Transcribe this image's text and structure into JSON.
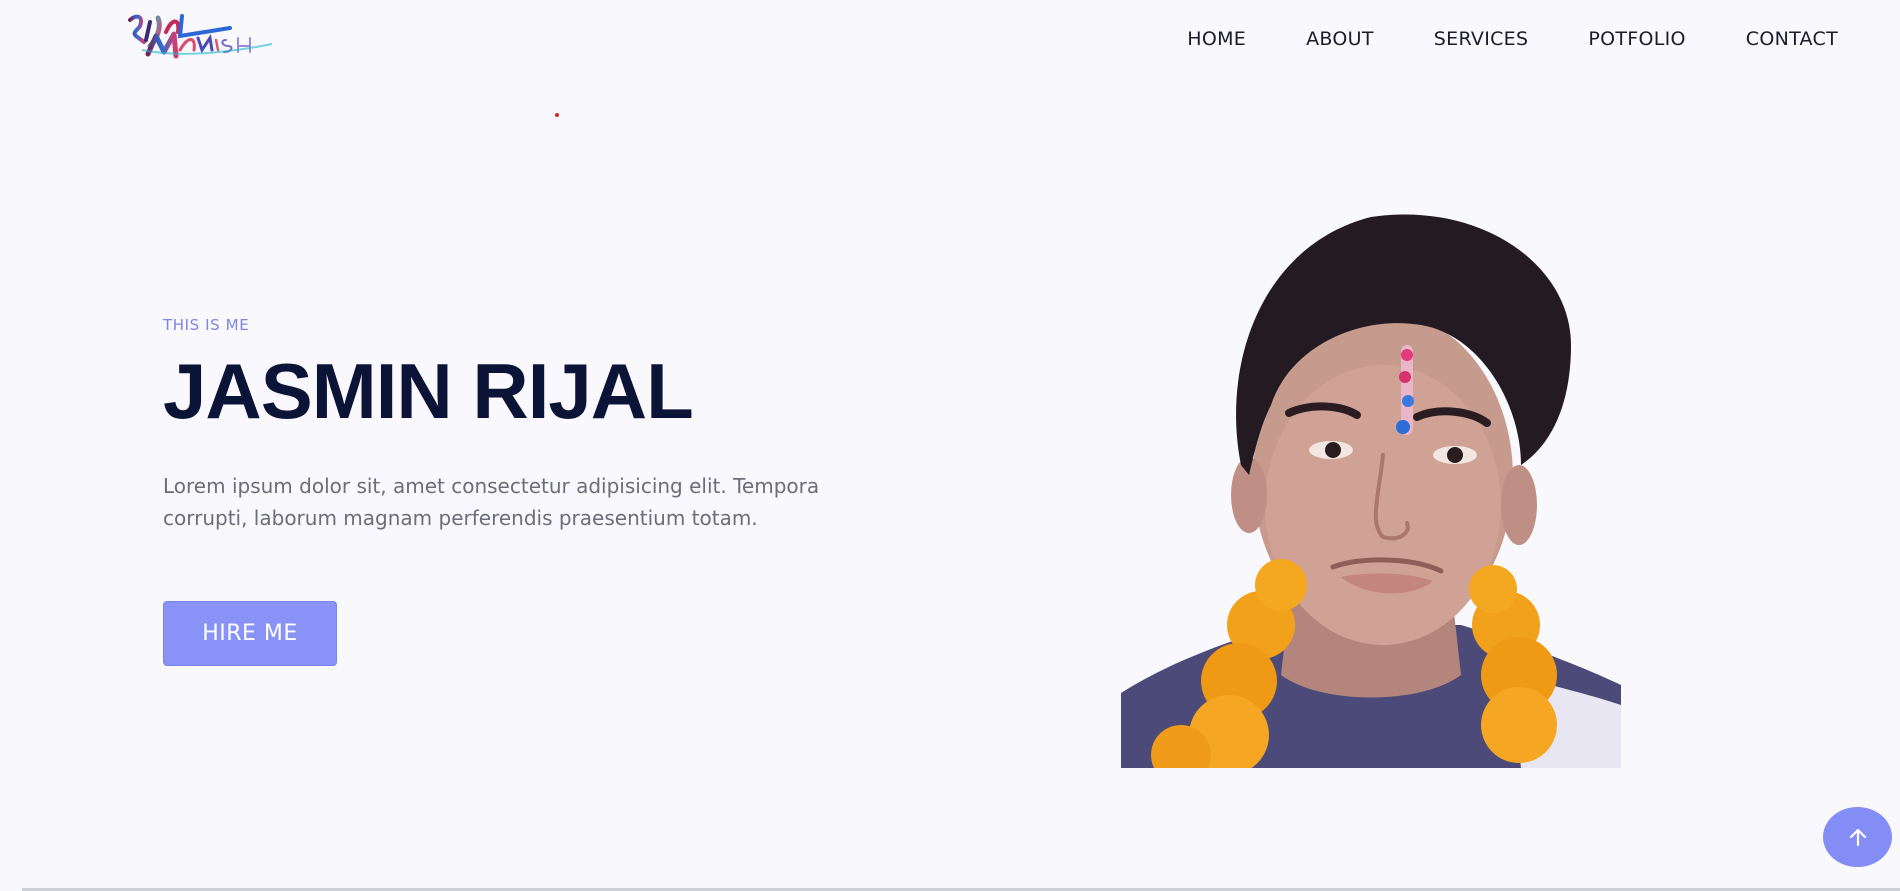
{
  "logo": {
    "alt_text": "RIJAL MANISH",
    "icon": "brand-logo"
  },
  "nav": {
    "items": [
      "HOME",
      "ABOUT",
      "SERVICES",
      "POTFOLIO",
      "CONTACT"
    ]
  },
  "hero": {
    "eyebrow": "THIS IS ME",
    "name": "JASMIN RIJAL",
    "description": "Lorem ipsum dolor sit, amet consectetur adipisicing elit. Tempora corrupti, laborum magnam perferendis praesentium totam.",
    "cta_label": "HIRE ME"
  },
  "portrait": {
    "icon": "profile-photo"
  },
  "scroll_top": {
    "icon": "arrow-up-icon"
  },
  "colors": {
    "background": "#f8f8fd",
    "accent": "#8992f6",
    "heading": "#0b1437",
    "eyebrow": "#7f85e0",
    "body_text": "#6d6d78"
  }
}
